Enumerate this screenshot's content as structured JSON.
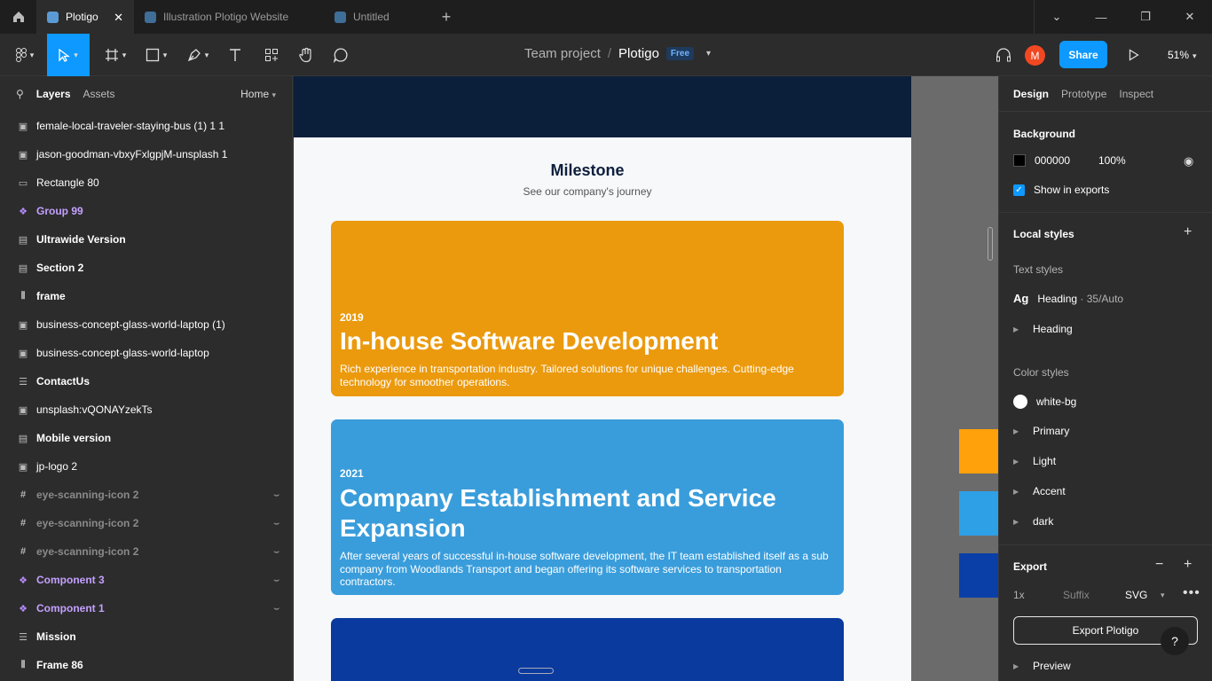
{
  "titlebar": {
    "tabs": [
      {
        "label": "Plotigo"
      },
      {
        "label": "Illustration Plotigo Website"
      },
      {
        "label": "Untitled"
      }
    ]
  },
  "toolbar": {
    "team": "Team project",
    "separator": "/",
    "file": "Plotigo",
    "plan_badge": "Free",
    "avatar_initial": "M",
    "share_label": "Share",
    "zoom": "51%"
  },
  "left_panel": {
    "tab_layers": "Layers",
    "tab_assets": "Assets",
    "page": "Home",
    "layers": [
      {
        "name": "female-local-traveler-staying-bus (1) 1 1",
        "icon": "image-icon"
      },
      {
        "name": "jason-goodman-vbxyFxlgpjM-unsplash 1",
        "icon": "image-icon"
      },
      {
        "name": "Rectangle 80",
        "icon": "rectangle-icon"
      },
      {
        "name": "Group 99",
        "icon": "component-icon"
      },
      {
        "name": "Ultrawide Version",
        "icon": "frame-icon"
      },
      {
        "name": "Section 2",
        "icon": "frame-icon"
      },
      {
        "name": "frame",
        "icon": "columns-icon"
      },
      {
        "name": "business-concept-glass-world-laptop (1)",
        "icon": "image-icon"
      },
      {
        "name": "business-concept-glass-world-laptop",
        "icon": "image-icon"
      },
      {
        "name": "ContactUs",
        "icon": "rows-icon"
      },
      {
        "name": "unsplash:vQONAYzekTs",
        "icon": "image-icon"
      },
      {
        "name": "Mobile version",
        "icon": "frame-icon"
      },
      {
        "name": "jp-logo 2",
        "icon": "image-icon"
      },
      {
        "name": "eye-scanning-icon 2",
        "icon": "hash-icon"
      },
      {
        "name": "eye-scanning-icon 2",
        "icon": "hash-icon"
      },
      {
        "name": "eye-scanning-icon 2",
        "icon": "hash-icon"
      },
      {
        "name": "Component 3",
        "icon": "component-icon"
      },
      {
        "name": "Component 1",
        "icon": "component-icon"
      },
      {
        "name": "Mission",
        "icon": "rows-icon"
      },
      {
        "name": "Frame 86",
        "icon": "columns-icon"
      }
    ]
  },
  "canvas": {
    "milestone_title": "Milestone",
    "milestone_subtitle": "See our company's journey",
    "cards": [
      {
        "year": "2019",
        "title": "In-house Software Development",
        "desc": "Rich experience in transportation industry. Tailored solutions for unique challenges. Cutting-edge technology for smoother operations.",
        "color": "#eb9a0e"
      },
      {
        "year": "2021",
        "title": "Company Establishment and Service Expansion",
        "desc": "After several years of successful in-house software development, the IT team established itself as a sub company from Woodlands Transport and began offering its software services to transportation contractors.",
        "color": "#3a9ddb"
      }
    ],
    "swatches": [
      "#ffa10a",
      "#2ea0e6",
      "#0a3fa8"
    ]
  },
  "right_panel": {
    "tab_design": "Design",
    "tab_prototype": "Prototype",
    "tab_inspect": "Inspect",
    "background_label": "Background",
    "bg_hex": "000000",
    "bg_opacity": "100%",
    "show_in_exports": "Show in exports",
    "local_styles": "Local styles",
    "text_styles": "Text styles",
    "text_style_ag": "Ag",
    "text_style_name": "Heading",
    "text_style_meta": "· 35/Auto",
    "text_style_group": "Heading",
    "color_styles": "Color styles",
    "color_style_items": [
      "white-bg",
      "Primary",
      "Light",
      "Accent",
      "dark"
    ],
    "export_label": "Export",
    "export_scale": "1x",
    "export_suffix": "Suffix",
    "export_format": "SVG",
    "export_button": "Export Plotigo",
    "preview": "Preview",
    "help": "?"
  }
}
